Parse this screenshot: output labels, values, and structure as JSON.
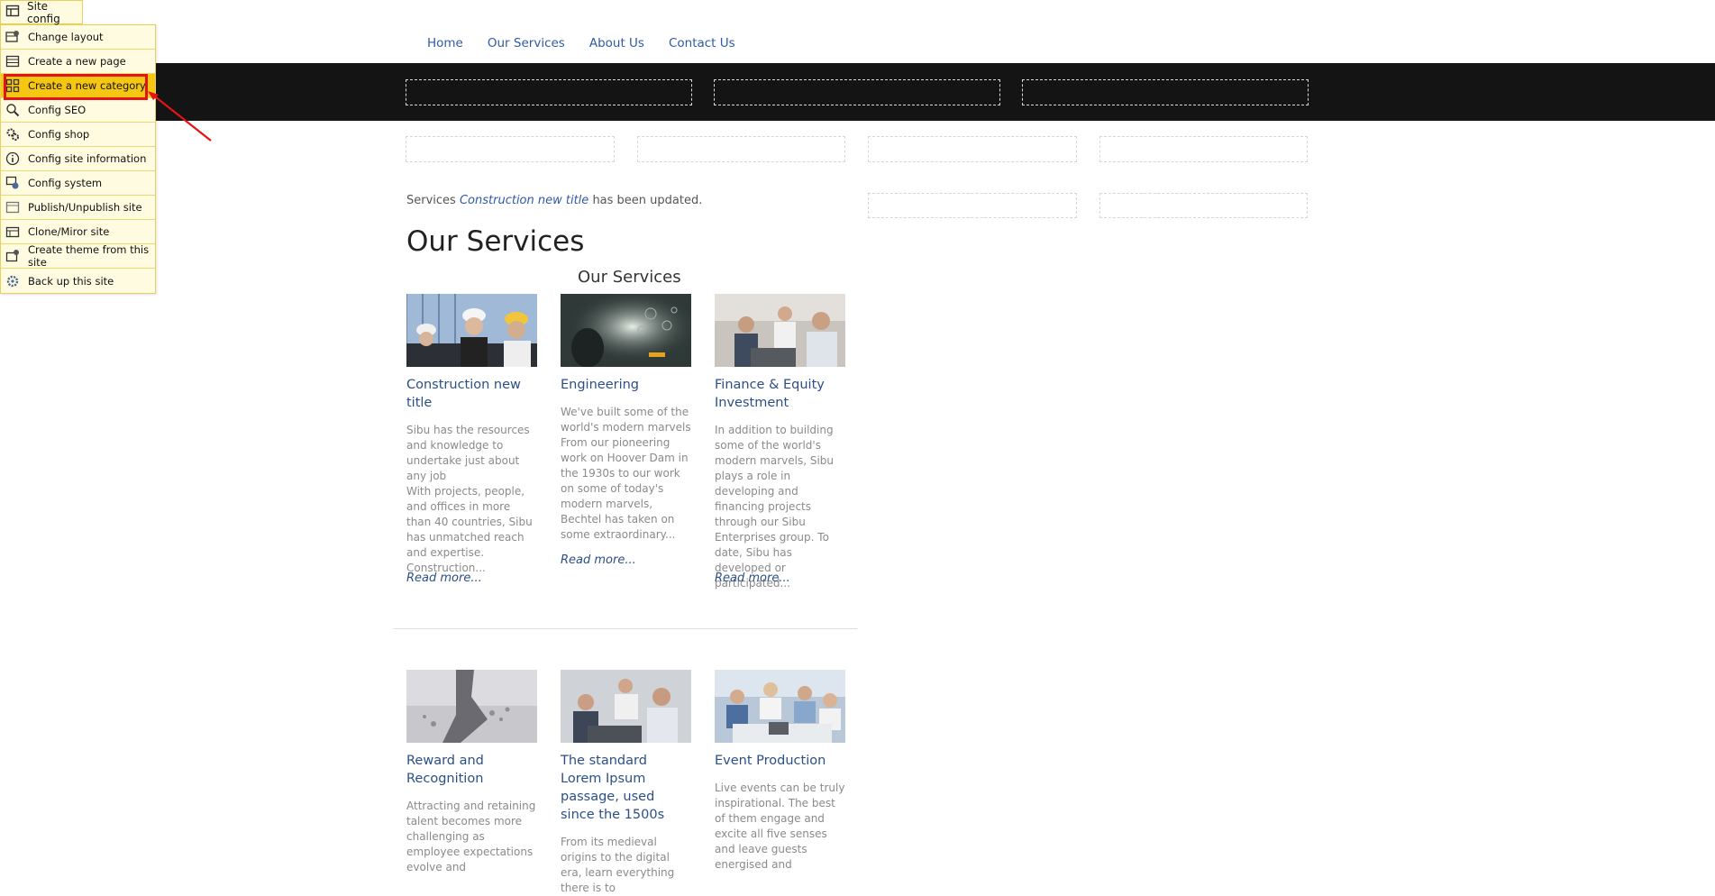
{
  "site_config": {
    "header_label": "Site config",
    "items": [
      {
        "label": "Change layout",
        "icon": "layout-icon"
      },
      {
        "label": "Create a new page",
        "icon": "page-icon"
      },
      {
        "label": "Create a new category",
        "icon": "category-icon"
      },
      {
        "label": "Config SEO",
        "icon": "seo-icon"
      },
      {
        "label": "Config shop",
        "icon": "gears-icon"
      },
      {
        "label": "Config site information",
        "icon": "info-icon"
      },
      {
        "label": "Config system",
        "icon": "system-icon"
      },
      {
        "label": "Publish/Unpublish site",
        "icon": "publish-icon"
      },
      {
        "label": "Clone/Miror site",
        "icon": "clone-icon"
      },
      {
        "label": "Create theme from this site",
        "icon": "theme-icon"
      },
      {
        "label": "Back up this site",
        "icon": "backup-icon"
      }
    ],
    "highlighted_item": "Create a new category"
  },
  "nav": {
    "items": [
      "Home",
      "Our Services",
      "About Us",
      "Contact Us"
    ],
    "link_color": "#2f5aa6"
  },
  "notice": {
    "prefix": "Services",
    "link": "Construction new title",
    "suffix": "has been updated."
  },
  "page_title": "Our Services",
  "section_title": "Our Services",
  "cards": [
    {
      "title": "Construction new title",
      "text": "Sibu has the resources and knowledge to undertake just about any job\nWith projects, people, and offices in more than 40 countries, Sibu has unmatched reach and expertise. Construction...",
      "more": "Read more..."
    },
    {
      "title": "Engineering",
      "text": "We've built some of the world's modern marvels From our pioneering work on Hoover Dam in the 1930s to our work on some of today's modern marvels, Bechtel has taken on some extraordinary...",
      "more": "Read more..."
    },
    {
      "title": "Finance & Equity Investment",
      "text": "In addition to building some of the world's modern marvels, Sibu plays a role in developing and financing projects through our Sibu Enterprises group. To date, Sibu has developed or participated...",
      "more": "Read more..."
    },
    {
      "title": "Reward and Recognition",
      "text": "Attracting and retaining talent becomes more challenging as employee expectations evolve and"
    },
    {
      "title": "The standard Lorem Ipsum passage, used since the 1500s",
      "text": "From its medieval origins to the digital era, learn everything there is to"
    },
    {
      "title": "Event Production",
      "text": "Live events can be truly inspirational. The best of them engage and excite all five senses and leave guests energised and"
    }
  ],
  "colors": {
    "menu_bg": "#fffbe0",
    "menu_highlight": "#f5c712",
    "annotation": "#e31414",
    "band": "#141414",
    "card_title": "#2b4f86"
  }
}
